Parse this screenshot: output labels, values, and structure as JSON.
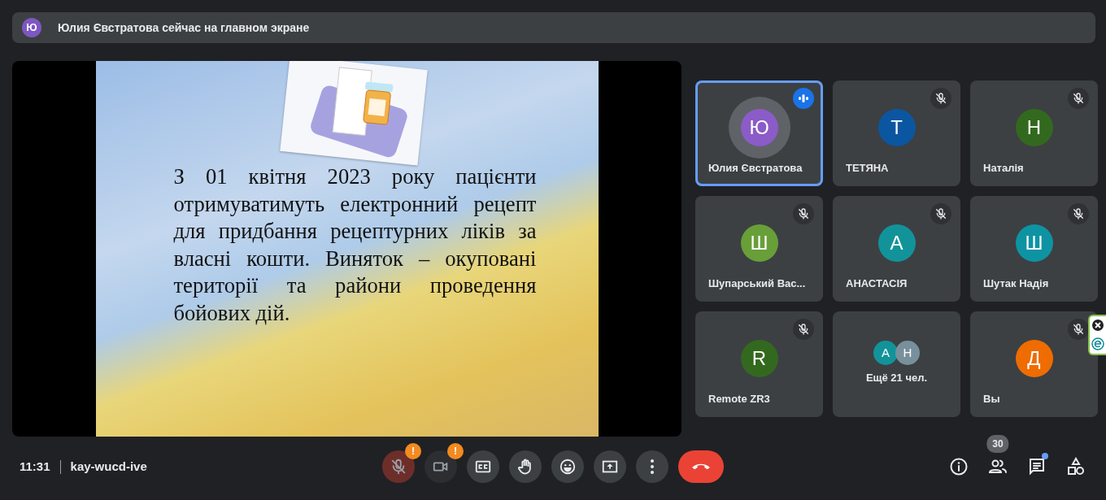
{
  "banner": {
    "avatar_initial": "Ю",
    "text": "Юлия Євстратова сейчас на главном экране"
  },
  "presentation": {
    "paragraph": "З 01 квітня 2023 року пацієнти отримуватимуть електронний рецепт для придбання рецептурних ліків за власні кошти. Виняток – окуповані території та райони проведення бойових дій."
  },
  "tiles": [
    {
      "kind": "person",
      "initial": "Ю",
      "name": "Юлия Євстратова",
      "color": "#8b5cc7",
      "speaking": true,
      "muted": false
    },
    {
      "kind": "person",
      "initial": "Т",
      "name": "ТЕТЯНА",
      "color": "#0b56a0",
      "speaking": false,
      "muted": true
    },
    {
      "kind": "person",
      "initial": "Н",
      "name": "Наталія",
      "color": "#33691e",
      "speaking": false,
      "muted": true
    },
    {
      "kind": "person",
      "initial": "Ш",
      "name": "Шупарський Вас...",
      "color": "#689f38",
      "speaking": false,
      "muted": true
    },
    {
      "kind": "person",
      "initial": "А",
      "name": "АНАСТАСІЯ",
      "color": "#12939a",
      "speaking": false,
      "muted": true
    },
    {
      "kind": "person",
      "initial": "Ш",
      "name": "Шутак Надія",
      "color": "#0e93a3",
      "speaking": false,
      "muted": true
    },
    {
      "kind": "person",
      "initial": "R",
      "name": "Remote ZR3",
      "color": "#33691e",
      "speaking": false,
      "muted": true
    },
    {
      "kind": "more",
      "label": "Ещё 21 чел.",
      "avatars": [
        {
          "initial": "А",
          "color": "#12939a"
        },
        {
          "initial": "Н",
          "color": "#78909c"
        }
      ]
    },
    {
      "kind": "person",
      "initial": "Д",
      "name": "Вы",
      "color": "#ef6c00",
      "speaking": false,
      "muted": true
    }
  ],
  "meeting": {
    "time": "11:31",
    "code": "kay-wucd-ive"
  },
  "controls": [
    {
      "kind": "mic",
      "off": true,
      "warning": "!"
    },
    {
      "kind": "camera",
      "off": true,
      "warning": "!"
    },
    {
      "kind": "captions"
    },
    {
      "kind": "hand"
    },
    {
      "kind": "emoji"
    },
    {
      "kind": "present"
    },
    {
      "kind": "more"
    },
    {
      "kind": "leave"
    }
  ],
  "side_controls": [
    {
      "kind": "info"
    },
    {
      "kind": "people",
      "count": "30"
    },
    {
      "kind": "chat",
      "unread": true
    },
    {
      "kind": "activities"
    }
  ]
}
